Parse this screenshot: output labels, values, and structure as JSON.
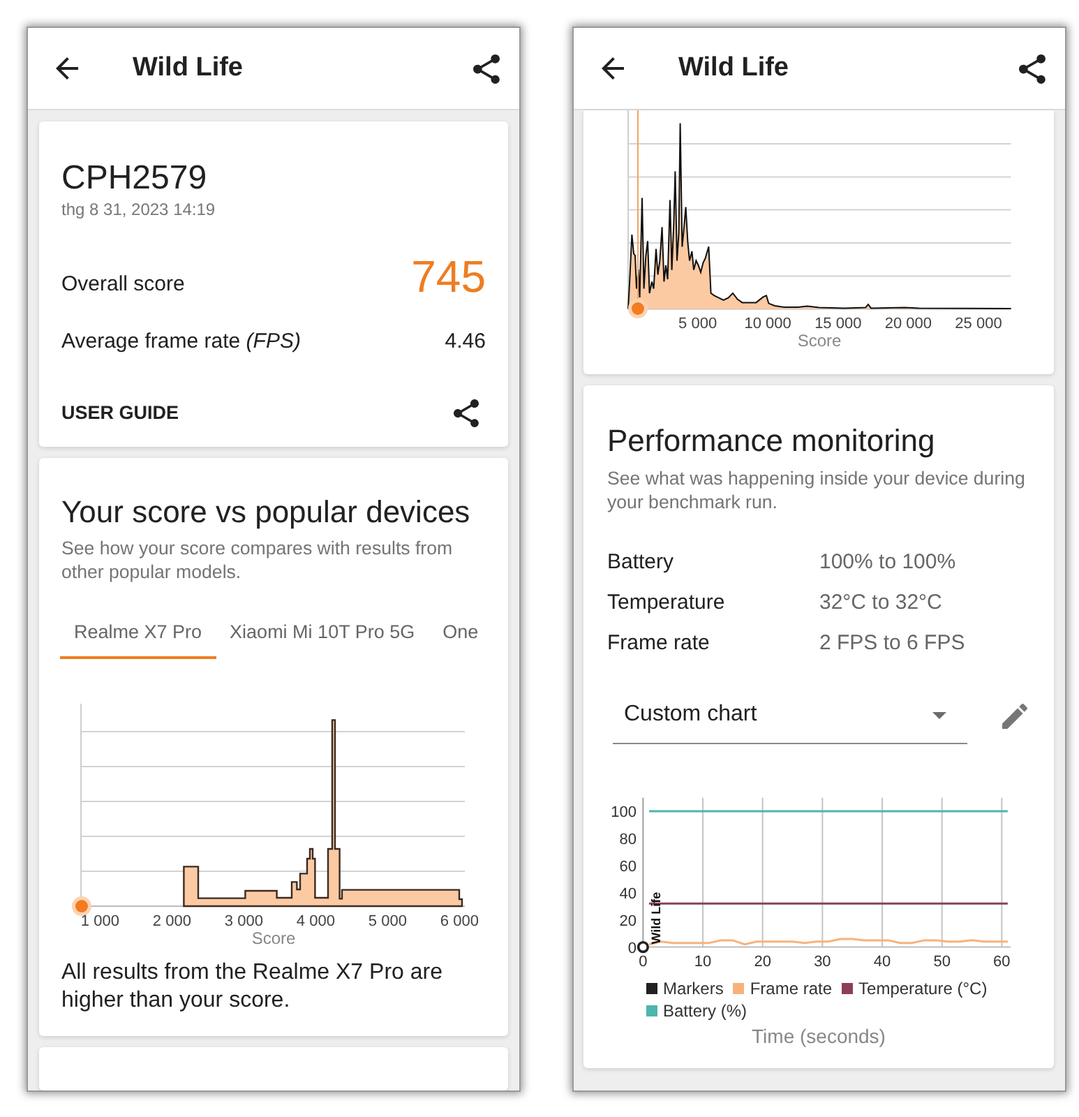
{
  "left_screen": {
    "app_bar": {
      "title": "Wild Life"
    },
    "result_card": {
      "device": "CPH2579",
      "date": "thg 8 31, 2023 14:19",
      "overall_score_label": "Overall score",
      "overall_score": "745",
      "fps_label": "Average frame rate *(FPS)*",
      "fps_value": "4.46",
      "user_guide": "USER GUIDE"
    },
    "comparison_card": {
      "title": "Your score vs popular devices",
      "subtitle": "See how your score compares with results from other popular models.",
      "tabs": [
        {
          "label": "Realme X7 Pro",
          "selected": true
        },
        {
          "label": "Xiaomi Mi 10T Pro 5G",
          "selected": false
        },
        {
          "label": "One",
          "selected": false
        }
      ],
      "x_tick_labels": [
        "1 000",
        "2 000",
        "3 000",
        "4 000",
        "5 000",
        "6 000"
      ],
      "x_axis_title": "Score",
      "caption": "All results from the Realme X7 Pro are higher than your score."
    }
  },
  "right_screen": {
    "app_bar": {
      "title": "Wild Life"
    },
    "distribution_card": {
      "x_tick_labels": [
        "5 000",
        "10 000",
        "15 000",
        "20 000",
        "25 000"
      ],
      "x_axis_title": "Score"
    },
    "performance_card": {
      "title": "Performance monitoring",
      "subtitle": "See what was happening inside your device during your benchmark run.",
      "stats": [
        {
          "label": "Battery",
          "value": "100% to 100%"
        },
        {
          "label": "Temperature",
          "value": "32°C to 32°C"
        },
        {
          "label": "Frame rate",
          "value": "2 FPS to 6 FPS"
        }
      ],
      "chart_select": {
        "value": "Custom chart"
      },
      "chart_data": {
        "type": "line",
        "xlabel": "Time (seconds)",
        "x": [
          0,
          1,
          3,
          5,
          7,
          9,
          11,
          13,
          15,
          17,
          19,
          21,
          23,
          25,
          27,
          29,
          31,
          33,
          35,
          37,
          39,
          41,
          43,
          45,
          47,
          49,
          51,
          53,
          55,
          57,
          59,
          61
        ],
        "series": [
          {
            "name": "Markers",
            "color": "#212121",
            "marker": true,
            "values": [
              0,
              null,
              null,
              null,
              null,
              null,
              null,
              null,
              null,
              null,
              null,
              null,
              null,
              null,
              null,
              null,
              null,
              null,
              null,
              null,
              null,
              null,
              null,
              null,
              null,
              null,
              null,
              null,
              null,
              null,
              null,
              null
            ]
          },
          {
            "name": "Frame rate",
            "color": "#f7b27c",
            "values": [
              null,
              2,
              4,
              3,
              3,
              3,
              3,
              5,
              5,
              2,
              4,
              4,
              4,
              4,
              3,
              4,
              4,
              6,
              6,
              5,
              5,
              5,
              3,
              3,
              5,
              5,
              4,
              4,
              5,
              4,
              4,
              4
            ]
          },
          {
            "name": "Temperature (°C)",
            "color": "#8d3f5a",
            "values": [
              null,
              32,
              32,
              32,
              32,
              32,
              32,
              32,
              32,
              32,
              32,
              32,
              32,
              32,
              32,
              32,
              32,
              32,
              32,
              32,
              32,
              32,
              32,
              32,
              32,
              32,
              32,
              32,
              32,
              32,
              32,
              32
            ]
          },
          {
            "name": "Battery (%)",
            "color": "#4db6ac",
            "values": [
              null,
              100,
              100,
              100,
              100,
              100,
              100,
              100,
              100,
              100,
              100,
              100,
              100,
              100,
              100,
              100,
              100,
              100,
              100,
              100,
              100,
              100,
              100,
              100,
              100,
              100,
              100,
              100,
              100,
              100,
              100,
              100
            ]
          }
        ],
        "xlim": [
          0,
          61.5
        ],
        "ylim": [
          0,
          110
        ],
        "xticks": [
          0,
          10,
          20,
          30,
          40,
          50,
          60
        ],
        "yticks": [
          0,
          20,
          40,
          60,
          80,
          100
        ],
        "grid": "x",
        "legend": "bottom",
        "annotations": [
          {
            "text": "Wild Life"
          }
        ]
      }
    }
  }
}
